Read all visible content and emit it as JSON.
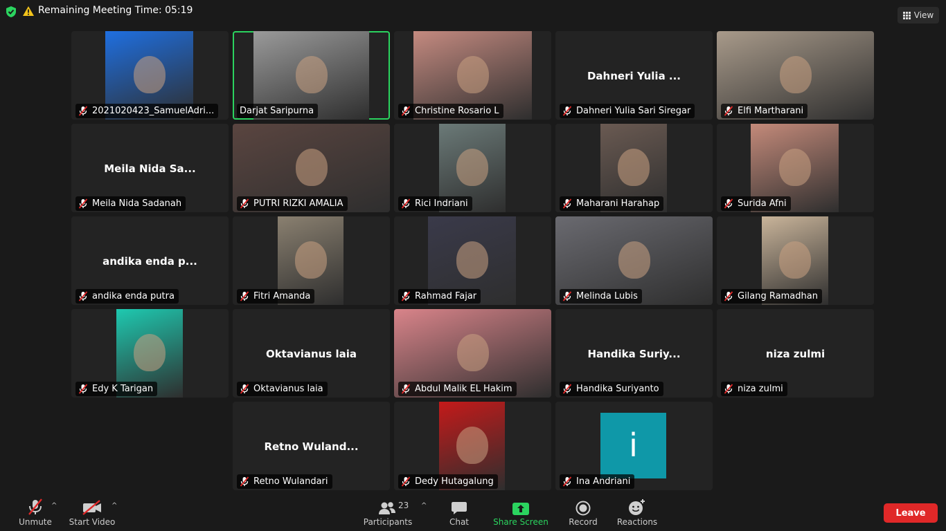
{
  "topbar": {
    "timer_text": "Remaining Meeting Time: 05:19",
    "view_label": "View"
  },
  "participants": [
    {
      "name": "2021020423_SamuelAdri...",
      "video": "photo",
      "color": "#1f6fe0"
    },
    {
      "name": "Darjat Saripurna",
      "video": "camera",
      "color": "#9a9a9a",
      "active": true
    },
    {
      "name": "Christine Rosario L",
      "video": "camera",
      "color": "#c48a80"
    },
    {
      "name": "Dahneri Yulia Sari Siregar",
      "display": "Dahneri Yulia ..."
    },
    {
      "name": "Elfi Martharani",
      "video": "camera",
      "color": "#a89a8a"
    },
    {
      "name": "Meila Nida Sadanah",
      "display": "Meila Nida Sa..."
    },
    {
      "name": "PUTRI RIZKI AMALIA",
      "video": "camera",
      "color": "#5a4540"
    },
    {
      "name": "Rici Indriani",
      "video": "camera",
      "color": "#6b7a78"
    },
    {
      "name": "Maharani Harahap",
      "video": "camera",
      "color": "#6a5a52"
    },
    {
      "name": "Surida Afni",
      "video": "camera",
      "color": "#c48a7a"
    },
    {
      "name": "andika enda putra",
      "display": "andika enda p..."
    },
    {
      "name": "Fitri Amanda",
      "video": "photo",
      "color": "#8a8070"
    },
    {
      "name": "Rahmad Fajar",
      "video": "photo",
      "color": "#3a3a4a"
    },
    {
      "name": "Melinda Lubis",
      "video": "camera",
      "color": "#6a6a70"
    },
    {
      "name": "Gilang Ramadhan",
      "video": "camera",
      "color": "#c9b49a"
    },
    {
      "name": "Edy K Tarigan",
      "video": "camera",
      "color": "#1ec9b0"
    },
    {
      "name": "Oktavianus laia",
      "display": "Oktavianus laia"
    },
    {
      "name": "Abdul Malik EL Hakim",
      "video": "camera",
      "color": "#d9848a"
    },
    {
      "name": "Handika Suriyanto",
      "display": "Handika Suriy..."
    },
    {
      "name": "niza zulmi",
      "display": "niza zulmi"
    },
    {
      "name": "Retno Wulandari",
      "display": "Retno Wuland..."
    },
    {
      "name": "Dedy Hutagalung",
      "video": "photo",
      "color": "#c41a1a"
    },
    {
      "name": "Ina Andriani",
      "avatar_letter": "i",
      "color": "#0f98a8"
    }
  ],
  "toolbar": {
    "unmute_label": "Unmute",
    "start_video_label": "Start Video",
    "participants_label": "Participants",
    "participants_count": "23",
    "chat_label": "Chat",
    "share_label": "Share Screen",
    "record_label": "Record",
    "reactions_label": "Reactions",
    "leave_label": "Leave"
  },
  "colors": {
    "accent_green": "#2bd45f",
    "leave_red": "#e02828",
    "tile_bg": "#232323"
  }
}
